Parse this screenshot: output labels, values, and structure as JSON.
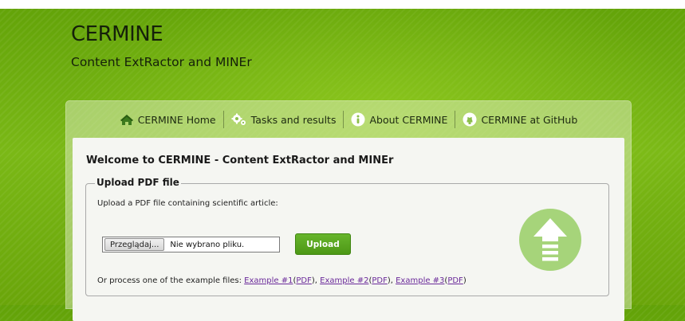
{
  "header": {
    "title": "CERMINE",
    "subtitle": "Content ExtRactor and MINEr"
  },
  "nav": {
    "items": [
      {
        "label": "CERMINE Home",
        "icon": "home-icon"
      },
      {
        "label": "Tasks and results",
        "icon": "gears-icon"
      },
      {
        "label": "About CERMINE",
        "icon": "info-icon"
      },
      {
        "label": "CERMINE at GitHub",
        "icon": "github-icon"
      }
    ]
  },
  "main": {
    "heading": "Welcome to CERMINE - Content ExtRactor and MINEr",
    "upload": {
      "legend": "Upload PDF file",
      "instruction": "Upload a PDF file containing scientific article:",
      "browse_label": "Przeglądaj...",
      "file_status": "Nie wybrano pliku.",
      "upload_label": "Upload",
      "upload_icon": "upload-arrow-icon"
    },
    "examples": {
      "prefix": "Or process one of the example files: ",
      "items": [
        {
          "label": "Example #1",
          "pdf": "PDF"
        },
        {
          "label": "Example #2",
          "pdf": "PDF"
        },
        {
          "label": "Example #3",
          "pdf": "PDF"
        }
      ],
      "separator": ", "
    }
  },
  "colors": {
    "background": "#6aa50a",
    "accent": "#4d9816",
    "upload_icon": "#a6d47a",
    "link": "#6a2a9a"
  }
}
